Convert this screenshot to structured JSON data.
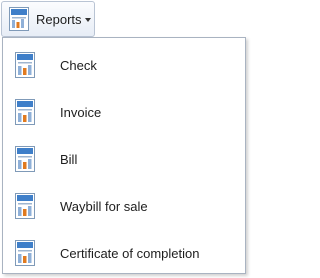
{
  "toolbar": {
    "reports_label": "Reports"
  },
  "menu": {
    "items": [
      {
        "label": "Check",
        "icon": "report-icon"
      },
      {
        "label": "Invoice",
        "icon": "report-icon"
      },
      {
        "label": "Bill",
        "icon": "report-icon"
      },
      {
        "label": "Waybill for sale",
        "icon": "report-icon"
      },
      {
        "label": "Certificate of completion",
        "icon": "report-icon"
      }
    ]
  },
  "colors": {
    "button_border": "#b9c4d4",
    "menu_border": "#a9b3c1",
    "icon_blue": "#3f7fc9",
    "icon_orange": "#e07a1f"
  }
}
